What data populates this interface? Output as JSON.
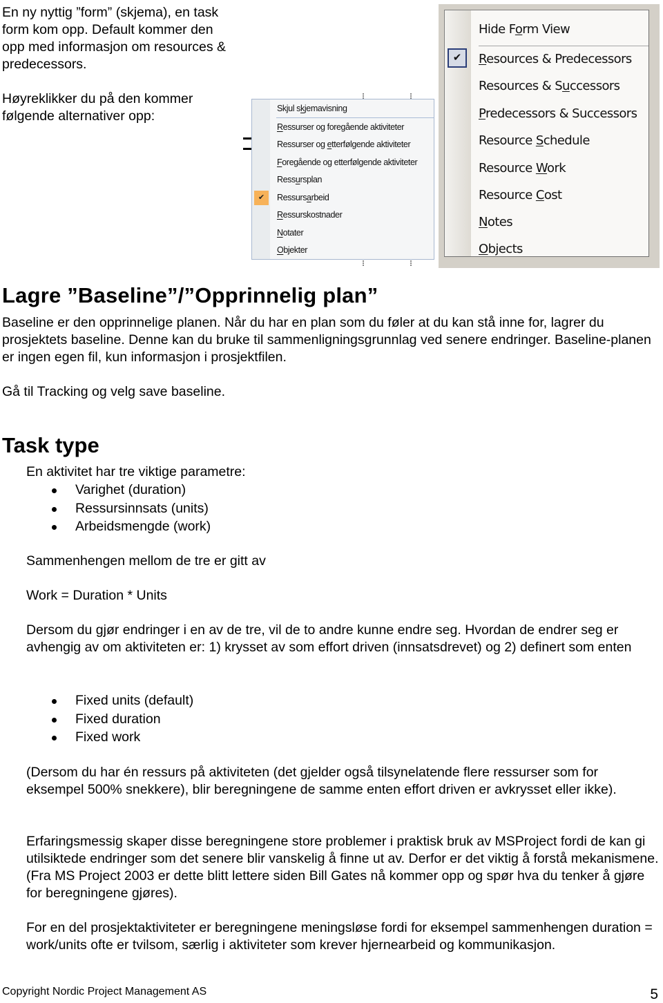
{
  "intro": {
    "paragraph_1": "En ny nyttig ”form” (skjema), en task form kom opp. Default kommer den opp med informasjon om resources & predecessors.",
    "paragraph_2": "Høyreklikker du på den kommer følgende alternativer opp:"
  },
  "menu_no": {
    "items": [
      {
        "pre": "Skjul s",
        "u": "k",
        "post": "jemavisning"
      },
      {
        "pre": "",
        "u": "R",
        "post": "essurser og foregående aktiviteter"
      },
      {
        "pre": "Ressurser og ",
        "u": "e",
        "post": "tterfølgende aktiviteter"
      },
      {
        "pre": "",
        "u": "F",
        "post": "oregående og etterfølgende aktiviteter"
      },
      {
        "pre": "Ress",
        "u": "u",
        "post": "rsplan"
      },
      {
        "pre": "Ressurs",
        "u": "a",
        "post": "rbeid"
      },
      {
        "pre": "",
        "u": "R",
        "post": "essurskostnader"
      },
      {
        "pre": "",
        "u": "N",
        "post": "otater"
      },
      {
        "pre": "",
        "u": "O",
        "post": "bjekter"
      }
    ],
    "checked_item": "Ressursarbeid",
    "check_icon": "✔",
    "highlight_color": "#f7b259"
  },
  "menu_en": {
    "items": [
      {
        "pre": "Hide F",
        "u": "o",
        "post": "rm View"
      },
      {
        "pre": "",
        "u": "R",
        "post": "esources & Predecessors"
      },
      {
        "pre": "Resources & S",
        "u": "u",
        "post": "ccessors"
      },
      {
        "pre": "",
        "u": "P",
        "post": "redecessors & Successors"
      },
      {
        "pre": "Resource ",
        "u": "S",
        "post": "chedule"
      },
      {
        "pre": "Resource ",
        "u": "W",
        "post": "ork"
      },
      {
        "pre": "Resource ",
        "u": "C",
        "post": "ost"
      },
      {
        "pre": "",
        "u": "N",
        "post": "otes"
      },
      {
        "pre": "",
        "u": "O",
        "post": "bjects"
      }
    ],
    "checked_item": "Resources & Predecessors",
    "check_icon": "✔"
  },
  "baseline": {
    "heading": "Lagre ”Baseline”/”Opprinnelig plan”",
    "paragraph_1": "Baseline er den opprinnelige planen. Når du har en plan som du føler at du kan stå inne for, lagrer du prosjektets baseline. Denne kan du bruke til sammenligningsgrunnlag ved senere endringer. Baseline-planen er ingen egen fil, kun informasjon i prosjektfilen.",
    "paragraph_2": "Gå til Tracking og velg save baseline."
  },
  "task_type": {
    "heading": "Task type",
    "intro": "En aktivitet har tre viktige parametre:",
    "parameters": [
      "Varighet (duration)",
      "Ressursinnsats (units)",
      "Arbeidsmengde (work)"
    ],
    "relation_text": "Sammenhengen mellom de tre er gitt av",
    "formula": "Work = Duration * Units",
    "change_text": "Dersom du gjør endringer i en av de tre, vil de to andre kunne endre seg. Hvordan de endrer seg er avhengig av om aktiviteten er: 1) krysset av som effort driven (innsatsdrevet) og 2) definert som enten",
    "types": [
      "Fixed units (default)",
      "Fixed duration",
      "Fixed work"
    ],
    "note_text": "(Dersom du har én ressurs på aktiviteten (det gjelder også tilsynelatende flere ressurser som for eksempel 500% snekkere), blir beregningene de samme enten effort driven er avkrysset eller ikke).",
    "experience_text": "Erfaringsmessig skaper disse beregningene store problemer i praktisk bruk av MSProject fordi de kan gi utilsiktede endringer som det senere blir vanskelig å finne ut av. Derfor er det viktig å forstå mekanismene. (Fra MS Project 2003 er dette blitt lettere siden Bill Gates nå kommer opp og spør hva du tenker å gjøre for beregningene gjøres).",
    "closing_text": "For en del prosjektaktiviteter er beregningene meningsløse fordi for eksempel sammenhengen duration = work/units ofte er tvilsom, særlig i aktiviteter som krever hjernearbeid og kommunikasjon."
  },
  "footer": {
    "copyright": "Copyright Nordic Project Management AS",
    "page_number": "5"
  }
}
